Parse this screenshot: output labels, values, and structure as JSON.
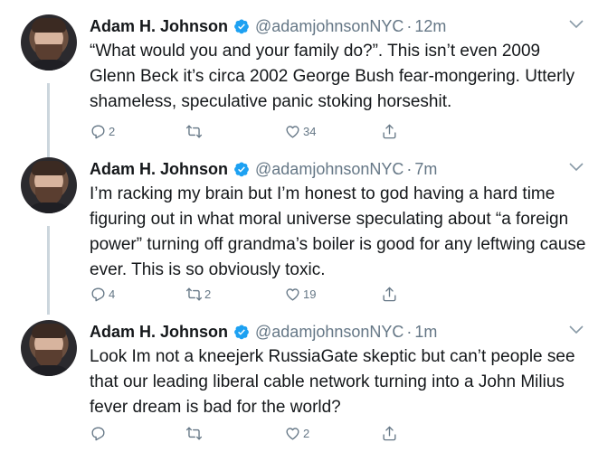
{
  "tweets": [
    {
      "author": "Adam H. Johnson",
      "handle": "@adamjohnsonNYC",
      "sep": "·",
      "time": "12m",
      "text": "“What would you and your family do?”. This isn’t even 2009 Glenn Beck it’s circa 2002 George Bush fear-mongering. Utterly shameless, speculative panic stoking horseshit.",
      "replies": "2",
      "retweets": "",
      "likes": "34"
    },
    {
      "author": "Adam H. Johnson",
      "handle": "@adamjohnsonNYC",
      "sep": "·",
      "time": "7m",
      "text": "I’m racking my brain but I’m honest to god having a hard time figuring out in what moral universe speculating about “a foreign power” turning off grandma’s boiler is good for any leftwing cause ever. This is so obviously toxic.",
      "replies": "4",
      "retweets": "2",
      "likes": "19"
    },
    {
      "author": "Adam H. Johnson",
      "handle": "@adamjohnsonNYC",
      "sep": "·",
      "time": "1m",
      "text": "Look Im not a kneejerk RussiaGate skeptic but can’t people see that our leading liberal cable network turning into a John Milius fever dream is bad for the world?",
      "replies": "",
      "retweets": "",
      "likes": "2"
    }
  ],
  "colors": {
    "verified": "#1da1f2",
    "muted": "#657786",
    "thread_line": "#ccd6dd"
  },
  "icons": [
    "verified-badge-icon",
    "chevron-down-icon",
    "reply-icon",
    "retweet-icon",
    "like-icon",
    "share-icon"
  ]
}
